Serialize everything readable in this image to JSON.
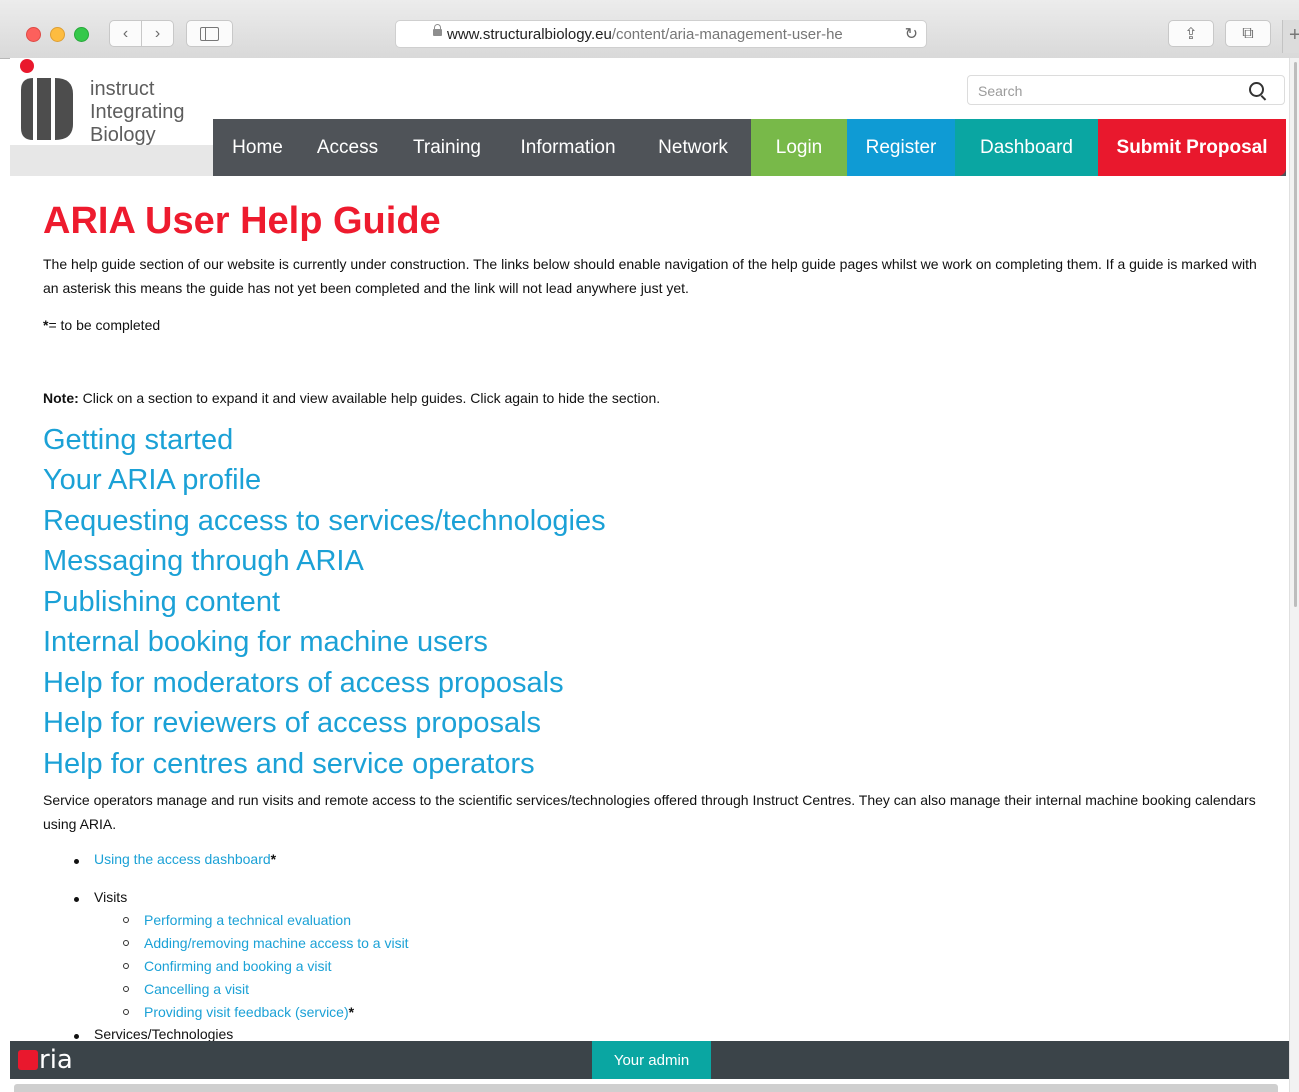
{
  "browser": {
    "url_domain": "www.structuralbiology.eu",
    "url_path": "/content/aria-management-user-he",
    "back_icon": "‹",
    "forward_icon": "›",
    "reload_icon": "↻",
    "share_icon": "⇪",
    "tabs_icon": "⧉",
    "newtab_icon": "+"
  },
  "brand": {
    "line1": "instruct",
    "line2": "Integrating",
    "line3": "Biology",
    "colors": {
      "red": "#e9182d",
      "dark": "#4d4d4d"
    }
  },
  "search": {
    "placeholder": "Search"
  },
  "nav": {
    "items": [
      {
        "label": "Home"
      },
      {
        "label": "Access"
      },
      {
        "label": "Training"
      },
      {
        "label": "Information"
      },
      {
        "label": "Network"
      },
      {
        "label": "Login"
      },
      {
        "label": "Register"
      },
      {
        "label": "Dashboard"
      },
      {
        "label": "Submit Proposal"
      }
    ],
    "colors": {
      "bar": "#4f5358",
      "login": "#78b949",
      "register": "#0f9bd4",
      "dashboard": "#0aa6a2",
      "submit": "#e9182d"
    }
  },
  "content": {
    "title": "ARIA User Help Guide",
    "intro": "The help guide section of our website is currently under construction. The links below should enable navigation of the help guide pages whilst we work on completing them. If a guide is marked with an asterisk this means the guide has not yet been completed and the link will not lead anywhere just yet.",
    "asterisk_star": "*",
    "asterisk_text": "= to be completed",
    "note_label": "Note:",
    "note_text": " Click on a section to expand it and view available help guides. Click again to hide the section.",
    "sections": [
      "Getting started",
      "Your ARIA profile",
      "Requesting access to services/technologies",
      "Messaging through ARIA",
      "Publishing content",
      "Internal booking for machine users",
      "Help for moderators of access proposals",
      "Help for reviewers of access proposals",
      "Help for centres and service operators"
    ],
    "service_desc": "Service operators manage and run visits and remote access to the scientific services/technologies offered through Instruct Centres. They can also manage their internal machine booking calendars using ARIA.",
    "list": {
      "dashboard_link": "Using the access dashboard",
      "dashboard_star": "*",
      "visits": "Visits",
      "visit_links": [
        "Performing a technical evaluation",
        "Adding/removing machine access to a visit",
        "Confirming and booking a visit",
        "Cancelling a visit",
        "Providing visit feedback (service)"
      ],
      "feedback_star": "*",
      "services": "Services/Technologies"
    }
  },
  "admin_bar": {
    "brand_text": "ria",
    "button": "Your admin"
  }
}
